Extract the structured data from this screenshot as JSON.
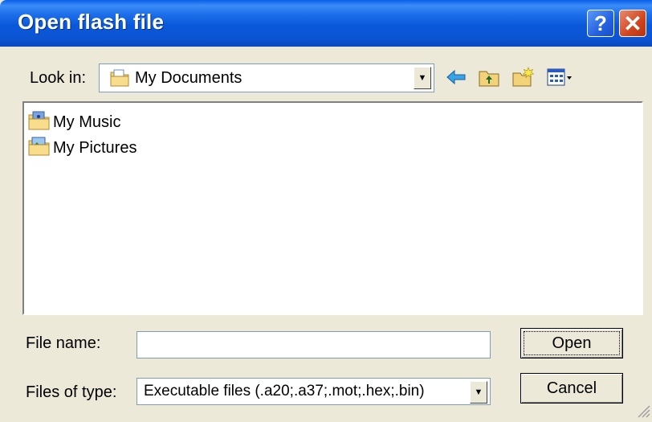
{
  "window": {
    "title": "Open flash file",
    "help_glyph": "?",
    "close_glyph": "✕"
  },
  "toolbar": {
    "look_in_label": "Look in:",
    "look_in_value": "My Documents",
    "icons": [
      "back-arrow-icon",
      "up-folder-icon",
      "new-folder-icon",
      "view-menu-icon"
    ]
  },
  "files": [
    {
      "name": "My Music",
      "icon": "music-folder-icon"
    },
    {
      "name": "My Pictures",
      "icon": "pictures-folder-icon"
    }
  ],
  "form": {
    "file_name_label": "File name:",
    "file_name_value": "",
    "file_type_label": "Files of type:",
    "file_type_value": "Executable files (.a20;.a37;.mot;.hex;.bin)"
  },
  "buttons": {
    "open": "Open",
    "cancel": "Cancel"
  },
  "colors": {
    "titlebar": "#0A58DA",
    "dialog_bg": "#ECE9D8",
    "close_red": "#D0451F"
  }
}
